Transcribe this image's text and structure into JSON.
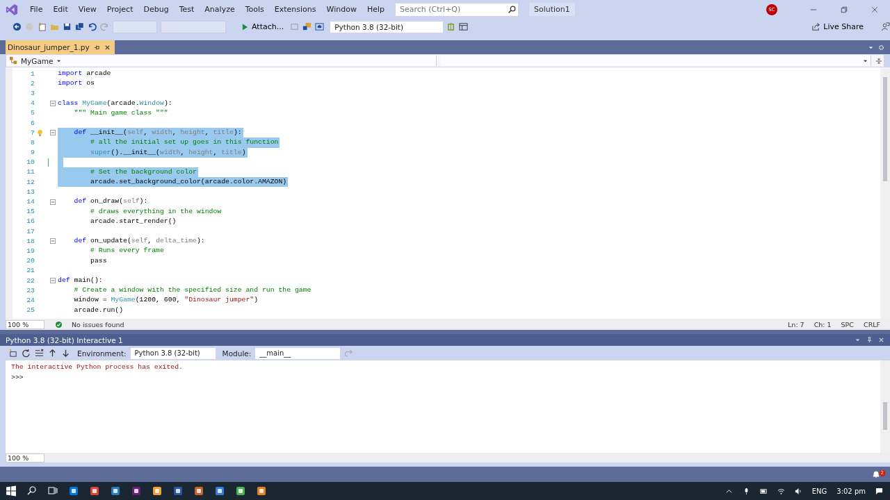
{
  "app_logo": {
    "kind": "logo"
  },
  "menu": [
    "File",
    "Edit",
    "View",
    "Project",
    "Debug",
    "Test",
    "Analyze",
    "Tools",
    "Extensions",
    "Window",
    "Help"
  ],
  "search": {
    "placeholder": "Search (Ctrl+Q)"
  },
  "solution": "Solution1",
  "account": {
    "initials": "SC"
  },
  "toolbar": {
    "attach": "Attach...",
    "environment": "Python 3.8 (32-bit)",
    "live_share": "Live Share"
  },
  "tabs": [
    {
      "label": "Dinosaur_jumper_1.py",
      "selected": true
    }
  ],
  "nav_bar": {
    "scope": "MyGame"
  },
  "code": [
    {
      "number": "1",
      "tokens": [
        {
          "kind": "kw",
          "text": "import"
        },
        {
          "kind": "text",
          "text": " arcade"
        }
      ],
      "selected": false,
      "fold": false,
      "changed": false
    },
    {
      "number": "2",
      "tokens": [
        {
          "kind": "kw",
          "text": "import"
        },
        {
          "kind": "text",
          "text": " os"
        }
      ],
      "selected": false,
      "fold": false,
      "changed": false
    },
    {
      "number": "3",
      "selected": false,
      "fold": false,
      "changed": false
    },
    {
      "number": "4",
      "tokens": [
        {
          "kind": "kw",
          "text": "class"
        },
        {
          "kind": "cls",
          "text": " MyGame"
        },
        {
          "kind": "text",
          "text": "(arcade."
        },
        {
          "kind": "cls",
          "text": "Window"
        },
        {
          "kind": "text",
          "text": "):"
        }
      ],
      "selected": false,
      "fold": true,
      "changed": false
    },
    {
      "number": "5",
      "tokens": [
        {
          "kind": "cm",
          "text": "    \"\"\" Main game class \"\"\""
        }
      ],
      "selected": false,
      "fold": false,
      "changed": false
    },
    {
      "number": "6",
      "selected": false,
      "fold": false,
      "changed": false
    },
    {
      "number": "7",
      "tokens": [
        {
          "kind": "kw",
          "text": "    def"
        },
        {
          "kind": "text",
          "text": " __init__("
        },
        {
          "kind": "param",
          "text": "self"
        },
        {
          "kind": "text",
          "text": ", "
        },
        {
          "kind": "param",
          "text": "width"
        },
        {
          "kind": "text",
          "text": ", "
        },
        {
          "kind": "param",
          "text": "height"
        },
        {
          "kind": "text",
          "text": ", "
        },
        {
          "kind": "param",
          "text": "title"
        },
        {
          "kind": "text",
          "text": "):"
        }
      ],
      "selected": true,
      "fold": true,
      "changed": false,
      "hint": true
    },
    {
      "number": "8",
      "tokens": [
        {
          "kind": "cm",
          "text": "        # all the initial set up goes in this function"
        }
      ],
      "selected": true,
      "fold": false,
      "changed": false
    },
    {
      "number": "9",
      "tokens": [
        {
          "kind": "cls",
          "text": "        super"
        },
        {
          "kind": "text",
          "text": "().__init__("
        },
        {
          "kind": "param",
          "text": "width"
        },
        {
          "kind": "text",
          "text": ", "
        },
        {
          "kind": "param",
          "text": "height"
        },
        {
          "kind": "text",
          "text": ", "
        },
        {
          "kind": "param",
          "text": "title"
        },
        {
          "kind": "text",
          "text": ")"
        }
      ],
      "selected": true,
      "fold": false,
      "changed": false
    },
    {
      "number": "10",
      "selected": true,
      "fold": false,
      "changed": true
    },
    {
      "number": "11",
      "tokens": [
        {
          "kind": "cm",
          "text": "        # Set the background color"
        }
      ],
      "selected": true,
      "fold": false,
      "changed": false
    },
    {
      "number": "12",
      "tokens": [
        {
          "kind": "text",
          "text": "        arcade.set_background_color(arcade.color.AMAZON)"
        }
      ],
      "selected": true,
      "fold": false,
      "changed": false
    },
    {
      "number": "13",
      "selected": false,
      "fold": false,
      "changed": false
    },
    {
      "number": "14",
      "tokens": [
        {
          "kind": "kw",
          "text": "    def"
        },
        {
          "kind": "text",
          "text": " on_draw("
        },
        {
          "kind": "param",
          "text": "self"
        },
        {
          "kind": "text",
          "text": "):"
        }
      ],
      "selected": false,
      "fold": true,
      "changed": false
    },
    {
      "number": "15",
      "tokens": [
        {
          "kind": "cm",
          "text": "        # draws everything in the window"
        }
      ],
      "selected": false,
      "fold": false,
      "changed": false
    },
    {
      "number": "16",
      "tokens": [
        {
          "kind": "text",
          "text": "        arcade.start_render()"
        }
      ],
      "selected": false,
      "fold": false,
      "changed": false
    },
    {
      "number": "17",
      "selected": false,
      "fold": false,
      "changed": false
    },
    {
      "number": "18",
      "tokens": [
        {
          "kind": "kw",
          "text": "    def"
        },
        {
          "kind": "text",
          "text": " on_update("
        },
        {
          "kind": "param",
          "text": "self"
        },
        {
          "kind": "text",
          "text": ", "
        },
        {
          "kind": "param",
          "text": "delta_time"
        },
        {
          "kind": "text",
          "text": "):"
        }
      ],
      "selected": false,
      "fold": true,
      "changed": false
    },
    {
      "number": "19",
      "tokens": [
        {
          "kind": "cm",
          "text": "        # Runs every frame"
        }
      ],
      "selected": false,
      "fold": false,
      "changed": false
    },
    {
      "number": "20",
      "tokens": [
        {
          "kind": "text",
          "text": "        pass"
        }
      ],
      "selected": false,
      "fold": false,
      "changed": false
    },
    {
      "number": "21",
      "selected": false,
      "fold": false,
      "changed": false
    },
    {
      "number": "22",
      "tokens": [
        {
          "kind": "kw",
          "text": "def"
        },
        {
          "kind": "text",
          "text": " main():"
        }
      ],
      "selected": false,
      "fold": true,
      "changed": false
    },
    {
      "number": "23",
      "tokens": [
        {
          "kind": "cm",
          "text": "    # Create a window with the specified size and run the game"
        }
      ],
      "selected": false,
      "fold": false,
      "changed": false
    },
    {
      "number": "24",
      "tokens": [
        {
          "kind": "text",
          "text": "    window = "
        },
        {
          "kind": "cls",
          "text": "MyGame"
        },
        {
          "kind": "text",
          "text": "(1200, 600, "
        },
        {
          "kind": "str",
          "text": "\"Dinosaur jumper\""
        },
        {
          "kind": "text",
          "text": ")"
        }
      ],
      "selected": false,
      "fold": false,
      "changed": false
    },
    {
      "number": "25",
      "tokens": [
        {
          "kind": "text",
          "text": "    arcade.run()"
        }
      ],
      "selected": false,
      "fold": false,
      "changed": false
    }
  ],
  "editor_status": {
    "zoom": "100 %",
    "issues": "No issues found",
    "line": "Ln: 7",
    "column": "Ch: 1",
    "indent": "SPC",
    "line_ending": "CRLF"
  },
  "interactive": {
    "title": "Python 3.8 (32-bit) Interactive 1",
    "environment_label": "Environment:",
    "environment": "Python 3.8 (32-bit)",
    "module_label": "Module:",
    "module": "__main__",
    "output": [
      {
        "kind": "error",
        "text": "The interactive Python process has exited."
      },
      {
        "kind": "prompt",
        "text": ">>>"
      }
    ],
    "zoom": "100 %"
  },
  "notifications": {
    "count": "2"
  },
  "taskbar": {
    "language": "ENG",
    "time": "3:02 pm"
  }
}
